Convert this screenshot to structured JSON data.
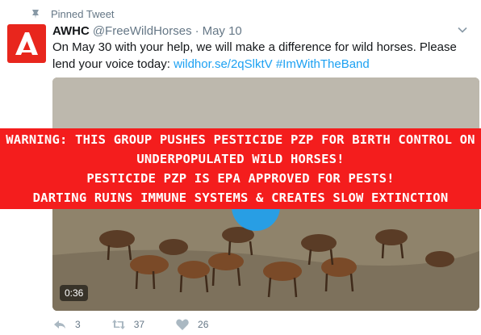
{
  "pinned": {
    "label": "Pinned Tweet",
    "icon": "pin-icon"
  },
  "tweet": {
    "name": "AWHC",
    "handle": "@FreeWildHorses",
    "separator": "·",
    "date": "May 10",
    "text": "On May 30 with your help, we will make a difference for wild horses. Please lend your voice today: ",
    "link": "wildhor.se/2qSlktV",
    "hashtag": "#ImWithTheBand"
  },
  "media": {
    "duration": "0:36"
  },
  "banner": {
    "lines": [
      "WARNING: THIS GROUP PUSHES PESTICIDE PZP FOR BIRTH CONTROL ON",
      "UNDERPOPULATED WILD HORSES!",
      "PESTICIDE PZP IS EPA APPROVED FOR PESTS!",
      "DARTING RUINS IMMUNE SYSTEMS & CREATES SLOW EXTINCTION"
    ],
    "color": "#f41d1d"
  },
  "actions": {
    "replies": "3",
    "retweets": "37",
    "likes": "26"
  },
  "colors": {
    "link": "#1da1f2",
    "muted": "#657786",
    "avatar": "#e8261d"
  }
}
